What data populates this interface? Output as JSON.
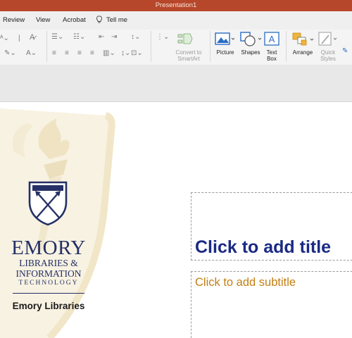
{
  "window": {
    "title": "Presentation1"
  },
  "menu": {
    "tabs": [
      "Review",
      "View",
      "Acrobat"
    ],
    "tell_me": "Tell me"
  },
  "ribbon": {
    "convert_smartart": [
      "Convert to",
      "SmartArt"
    ],
    "picture": "Picture",
    "shapes": "Shapes",
    "text_box": [
      "Text",
      "Box"
    ],
    "arrange": "Arrange",
    "quick_styles": [
      "Quick",
      "Styles"
    ]
  },
  "slide": {
    "title_placeholder": "Click to add title",
    "subtitle_placeholder": "Click to add subtitle",
    "logo": {
      "line1": "EMORY",
      "line2": "LIBRARIES &",
      "line3": "INFORMATION",
      "line4": "TECHNOLOGY",
      "name": "Emory Libraries"
    }
  },
  "colors": {
    "titlebar": "#b7472a",
    "title_text": "#1a2a84",
    "subtitle_text": "#c27f14",
    "logo_navy": "#243066",
    "watermark_gold": "#f3ead2"
  },
  "icons": [
    "lightbulb-icon",
    "picture-icon",
    "shapes-icon",
    "text-box-icon",
    "arrange-icon",
    "quick-styles-icon",
    "smartart-icon",
    "emory-shield-logo",
    "torch-watermark"
  ]
}
